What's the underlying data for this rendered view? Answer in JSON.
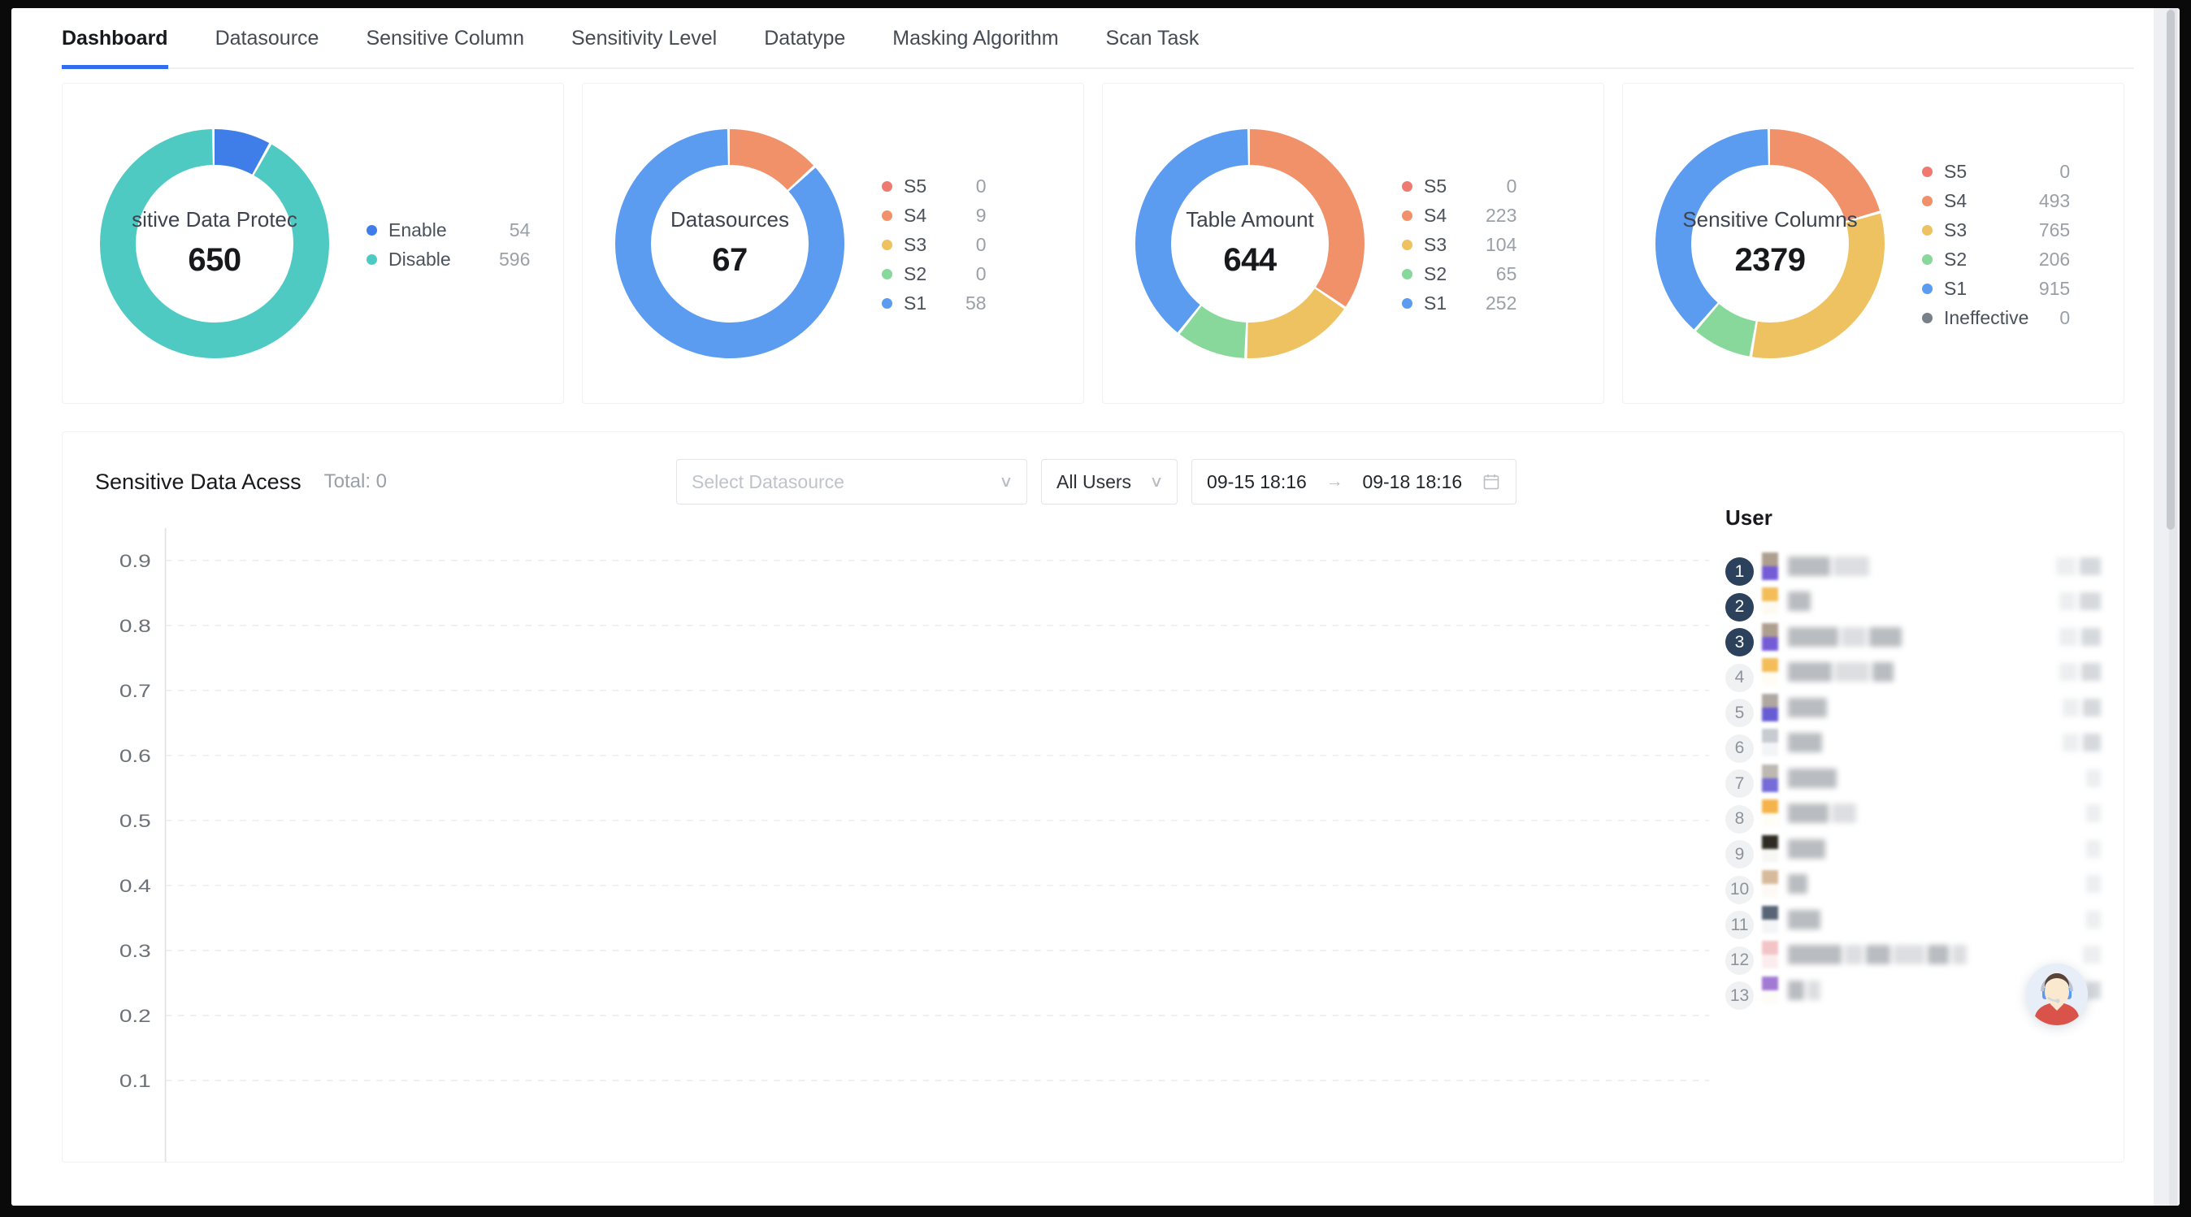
{
  "tabs": [
    {
      "label": "Dashboard",
      "active": true
    },
    {
      "label": "Datasource",
      "active": false
    },
    {
      "label": "Sensitive Column",
      "active": false
    },
    {
      "label": "Sensitivity Level",
      "active": false
    },
    {
      "label": "Datatype",
      "active": false
    },
    {
      "label": "Masking Algorithm",
      "active": false
    },
    {
      "label": "Scan Task",
      "active": false
    }
  ],
  "colors": {
    "accent": "#2f6ef0",
    "blue": "#5b9bf0",
    "teal": "#4ecac3",
    "orange": "#f0916a",
    "yellow": "#eec260",
    "green": "#87d89a",
    "red": "#ef7a72",
    "gray": "#78808a",
    "rank_top": "#2c415c",
    "rank_normal": "#f0f1f3"
  },
  "cards": [
    {
      "center_title": "sitive Data Protec",
      "center_value": "650",
      "legend": [
        {
          "label": "Enable",
          "value": "54",
          "color": "#3f7de8"
        },
        {
          "label": "Disable",
          "value": "596",
          "color": "#4ecac3"
        }
      ],
      "chart_data": {
        "type": "pie",
        "title": "Sensitive Data Protection",
        "categories": [
          "Enable",
          "Disable"
        ],
        "values": [
          54,
          596
        ],
        "colors": [
          "#3f7de8",
          "#4ecac3"
        ],
        "total": 650
      }
    },
    {
      "center_title": "Datasources",
      "center_value": "67",
      "legend": [
        {
          "label": "S5",
          "value": "0",
          "color": "#ef7a72"
        },
        {
          "label": "S4",
          "value": "9",
          "color": "#f0916a"
        },
        {
          "label": "S3",
          "value": "0",
          "color": "#eec260"
        },
        {
          "label": "S2",
          "value": "0",
          "color": "#87d89a"
        },
        {
          "label": "S1",
          "value": "58",
          "color": "#5b9bf0"
        }
      ],
      "chart_data": {
        "type": "pie",
        "title": "Datasources",
        "categories": [
          "S5",
          "S4",
          "S3",
          "S2",
          "S1"
        ],
        "values": [
          0,
          9,
          0,
          0,
          58
        ],
        "colors": [
          "#ef7a72",
          "#f0916a",
          "#eec260",
          "#87d89a",
          "#5b9bf0"
        ],
        "total": 67
      }
    },
    {
      "center_title": "Table Amount",
      "center_value": "644",
      "legend": [
        {
          "label": "S5",
          "value": "0",
          "color": "#ef7a72"
        },
        {
          "label": "S4",
          "value": "223",
          "color": "#f0916a"
        },
        {
          "label": "S3",
          "value": "104",
          "color": "#eec260"
        },
        {
          "label": "S2",
          "value": "65",
          "color": "#87d89a"
        },
        {
          "label": "S1",
          "value": "252",
          "color": "#5b9bf0"
        }
      ],
      "chart_data": {
        "type": "pie",
        "title": "Table Amount",
        "categories": [
          "S5",
          "S4",
          "S3",
          "S2",
          "S1"
        ],
        "values": [
          0,
          223,
          104,
          65,
          252
        ],
        "colors": [
          "#ef7a72",
          "#f0916a",
          "#eec260",
          "#87d89a",
          "#5b9bf0"
        ],
        "total": 644
      }
    },
    {
      "center_title": "Sensitive Columns",
      "center_value": "2379",
      "legend": [
        {
          "label": "S5",
          "value": "0",
          "color": "#ef7a72"
        },
        {
          "label": "S4",
          "value": "493",
          "color": "#f0916a"
        },
        {
          "label": "S3",
          "value": "765",
          "color": "#eec260"
        },
        {
          "label": "S2",
          "value": "206",
          "color": "#87d89a"
        },
        {
          "label": "S1",
          "value": "915",
          "color": "#5b9bf0"
        },
        {
          "label": "Ineffective",
          "value": "0",
          "color": "#78808a"
        }
      ],
      "chart_data": {
        "type": "pie",
        "title": "Sensitive Columns",
        "categories": [
          "S5",
          "S4",
          "S3",
          "S2",
          "S1",
          "Ineffective"
        ],
        "values": [
          0,
          493,
          765,
          206,
          915,
          0
        ],
        "colors": [
          "#ef7a72",
          "#f0916a",
          "#eec260",
          "#87d89a",
          "#5b9bf0",
          "#78808a"
        ],
        "total": 2379
      }
    }
  ],
  "access_panel": {
    "title": "Sensitive Data Acess",
    "total": "Total: 0",
    "datasource_placeholder": "Select Datasource",
    "datasource_value": "",
    "users_value": "All Users",
    "date_start": "09-15 18:16",
    "date_arrow": "→",
    "date_end": "09-18 18:16",
    "chart_data": {
      "type": "line",
      "title": "Sensitive Data Acess",
      "series": [],
      "x": [],
      "ylabel": "",
      "xlabel": "",
      "ylim": [
        0,
        1
      ],
      "yticks": [
        "0.9",
        "0.8",
        "0.7",
        "0.6",
        "0.5",
        "0.4",
        "0.3",
        "0.2",
        "0.1"
      ],
      "grid": true,
      "legend_position": "none",
      "empty": true
    }
  },
  "user_panel": {
    "title": "User",
    "rows": [
      {
        "rank": "1",
        "top": true
      },
      {
        "rank": "2",
        "top": true
      },
      {
        "rank": "3",
        "top": true
      },
      {
        "rank": "4",
        "top": false
      },
      {
        "rank": "5",
        "top": false
      },
      {
        "rank": "6",
        "top": false
      },
      {
        "rank": "7",
        "top": false
      },
      {
        "rank": "8",
        "top": false
      },
      {
        "rank": "9",
        "top": false
      },
      {
        "rank": "10",
        "top": false
      },
      {
        "rank": "11",
        "top": false
      },
      {
        "rank": "12",
        "top": false
      },
      {
        "rank": "13",
        "top": false
      }
    ]
  }
}
